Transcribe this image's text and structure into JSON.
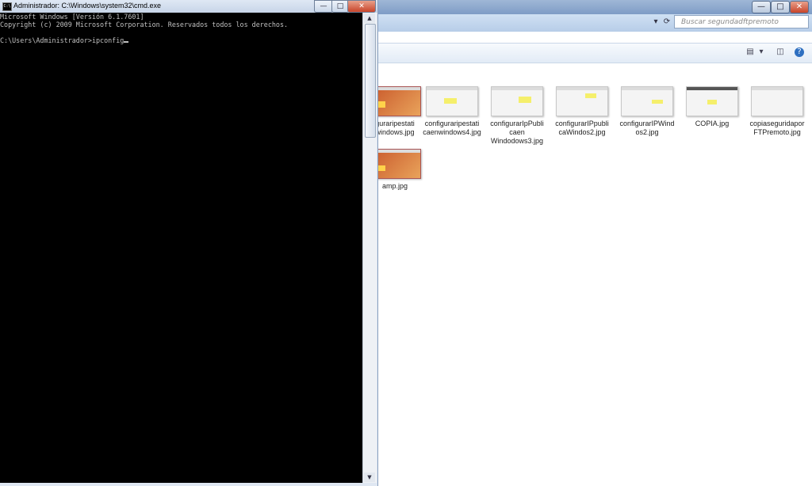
{
  "cmd": {
    "title": "Administrador: C:\\Windows\\system32\\cmd.exe",
    "icon_label": "C:\\",
    "lines": [
      "Microsoft Windows [Versión 6.1.7601]",
      "Copyright (c) 2009 Microsoft Corporation. Reservados todos los derechos.",
      "",
      "C:\\Users\\Administrador>ipconfig"
    ],
    "buttons": {
      "minimize": "—",
      "maximize": "□",
      "close": "✕"
    }
  },
  "explorer": {
    "search_placeholder": "Buscar segundadftpremoto",
    "window_buttons": {
      "minimize": "—",
      "maximize": "□",
      "close": "✕"
    },
    "files": [
      {
        "name": "guraripestati windows.jpg",
        "style": "orange"
      },
      {
        "name": "configuraripestati caenwindows4.jpg",
        "style": "plain"
      },
      {
        "name": "configurarIpPubli caen Windodows3.jpg",
        "style": "plain"
      },
      {
        "name": "configurarIPpubli caWindos2.jpg",
        "style": "plain"
      },
      {
        "name": "configurarIPWind os2.jpg",
        "style": "plain"
      },
      {
        "name": "COPIA.jpg",
        "style": "plain"
      },
      {
        "name": "copiaseguridapor FTPremoto.jpg",
        "style": "plain"
      },
      {
        "name": "amp.jpg",
        "style": "orange"
      }
    ]
  },
  "icons": [
    "cmd-icon",
    "refresh-icon",
    "search-icon",
    "view-icon",
    "preview-pane-icon",
    "help-icon"
  ]
}
